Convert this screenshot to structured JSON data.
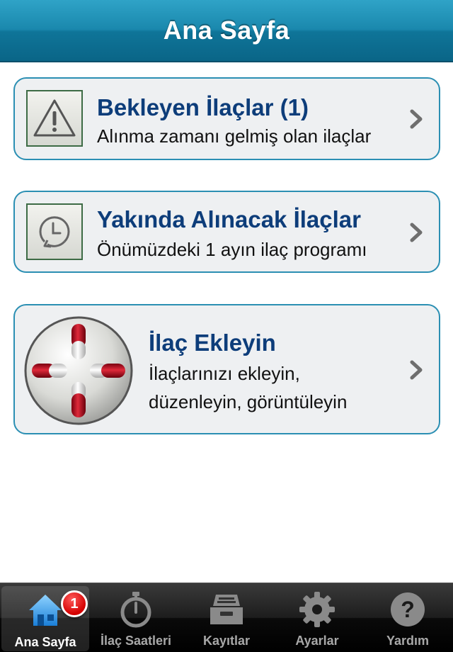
{
  "navbar": {
    "title": "Ana Sayfa"
  },
  "cards": [
    {
      "title": "Bekleyen İlaçlar (1)",
      "subtitle": "Alınma zamanı gelmiş olan ilaçlar",
      "icon": "warning-icon"
    },
    {
      "title": "Yakında Alınacak İlaçlar",
      "subtitle": "Önümüzdeki 1 ayın ilaç programı",
      "icon": "clock-refresh-icon"
    },
    {
      "title": "İlaç Ekleyin",
      "subtitle_line1": "İlaçlarınızı ekleyin,",
      "subtitle_line2": "düzenleyin, görüntüleyin",
      "icon": "pill-cross-icon"
    }
  ],
  "tabbar": {
    "tabs": [
      {
        "label": "Ana Sayfa",
        "icon": "home-icon",
        "badge": "1",
        "active": true
      },
      {
        "label": "İlaç Saatleri",
        "icon": "stopwatch-icon"
      },
      {
        "label": "Kayıtlar",
        "icon": "inbox-tray-icon"
      },
      {
        "label": "Ayarlar",
        "icon": "gear-icon"
      },
      {
        "label": "Yardım",
        "icon": "help-icon"
      }
    ]
  },
  "colors": {
    "accent": "#2b8fb3",
    "title_text": "#0d3d7a",
    "card_bg": "#eef0f2",
    "badge": "#d40000"
  }
}
